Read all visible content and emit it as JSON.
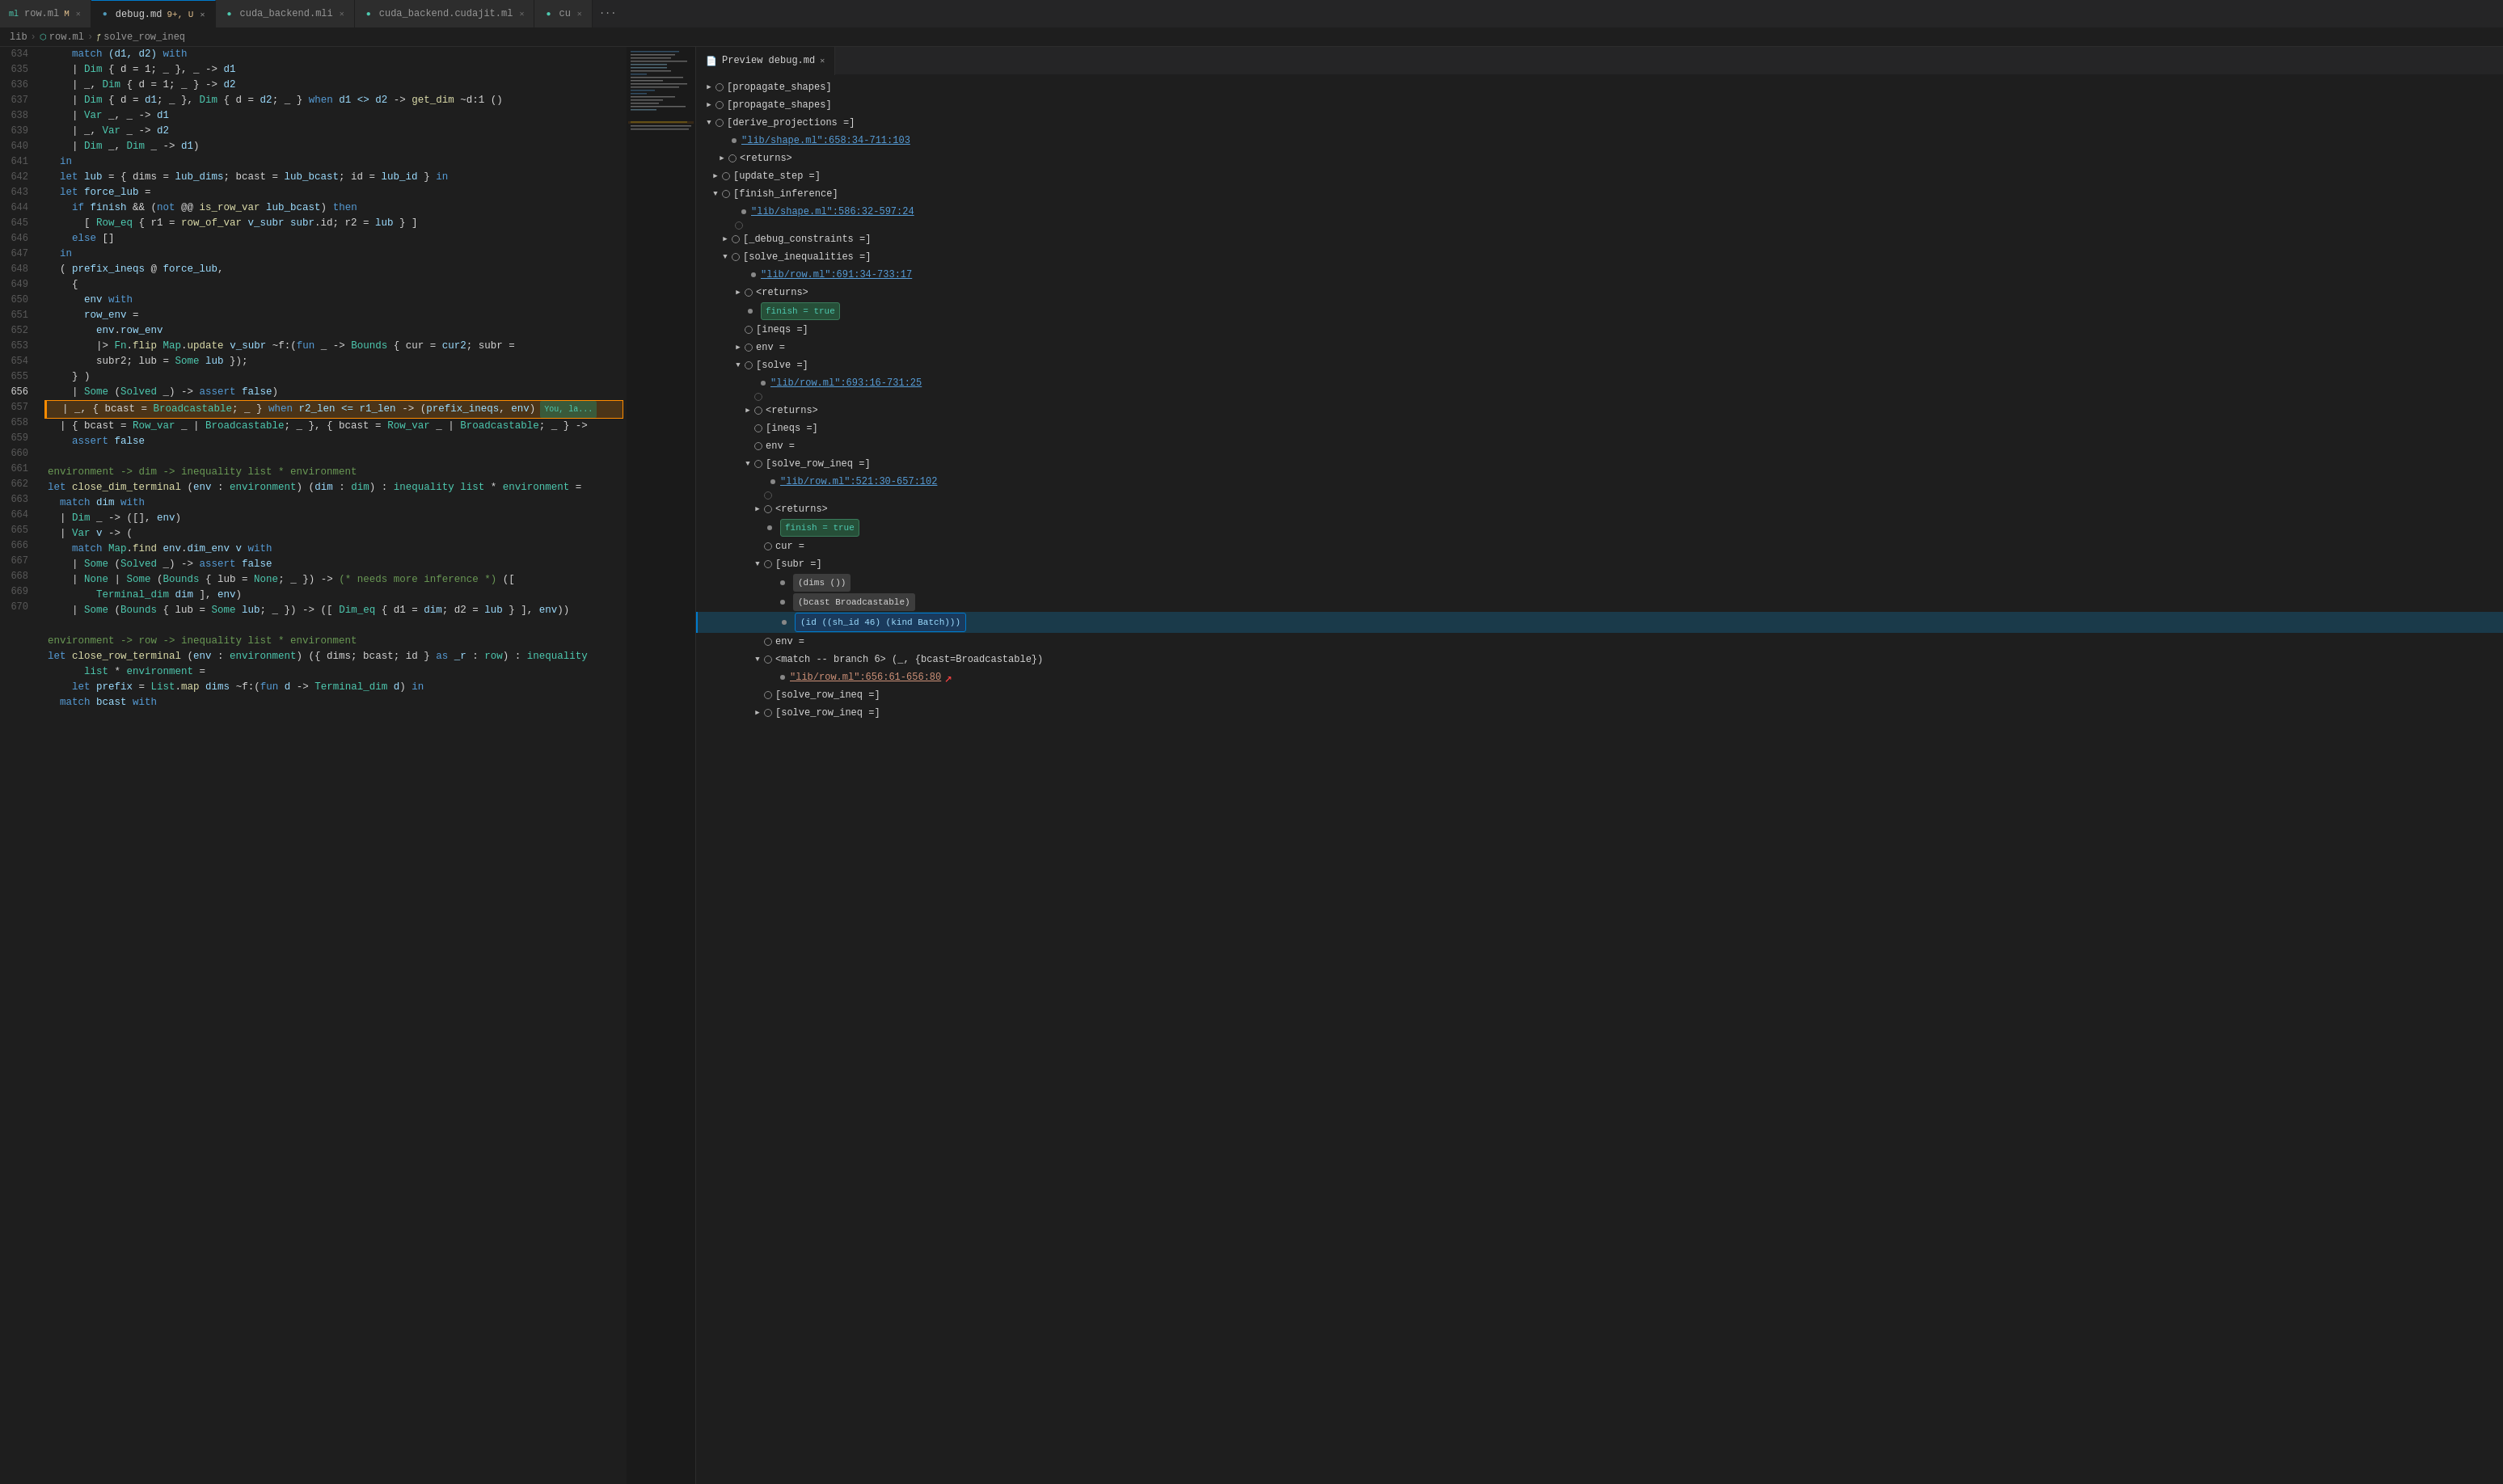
{
  "tabs": [
    {
      "id": "row-ml",
      "label": "row.ml",
      "modified": "M",
      "active": false,
      "icon": "ml"
    },
    {
      "id": "debug-md",
      "label": "debug.md",
      "modified": "9+, U",
      "active": true,
      "icon": "md"
    },
    {
      "id": "cuda-backend-mli",
      "label": "cuda_backend.mli",
      "modified": "",
      "active": false,
      "icon": "mli"
    },
    {
      "id": "cuda-backend-cudajit",
      "label": "cuda_backend.cudajit.ml",
      "modified": "",
      "active": false,
      "icon": "ml"
    },
    {
      "id": "cu",
      "label": "cu",
      "modified": "",
      "active": false,
      "icon": ""
    }
  ],
  "breadcrumb": {
    "parts": [
      "lib",
      "row.ml",
      "solve_row_ineq"
    ]
  },
  "lines": [
    {
      "num": 634,
      "text": "    match (d1, d2) with",
      "highlight": false
    },
    {
      "num": 635,
      "text": "    | Dim { d = 1; _ }, _ -> d1",
      "highlight": false
    },
    {
      "num": 636,
      "text": "    | _, Dim { d = 1; _ } -> d2",
      "highlight": false
    },
    {
      "num": 637,
      "text": "    | Dim { d = d1; _ }, Dim { d = d2; _ } when d1 <> d2 -> get_dim ~d:1 ()",
      "highlight": false
    },
    {
      "num": 638,
      "text": "    | Var _, _ -> d1",
      "highlight": false
    },
    {
      "num": 639,
      "text": "    | _, Var _ -> d2",
      "highlight": false
    },
    {
      "num": 640,
      "text": "    | Dim _, Dim _ -> d1)",
      "highlight": false
    },
    {
      "num": 641,
      "text": "  in",
      "highlight": false
    },
    {
      "num": 642,
      "text": "  let lub = { dims = lub_dims; bcast = lub_bcast; id = lub_id } in",
      "highlight": false
    },
    {
      "num": 643,
      "text": "  let force_lub =",
      "highlight": false
    },
    {
      "num": 644,
      "text": "    if finish && (not @@ is_row_var lub_bcast) then",
      "highlight": false
    },
    {
      "num": 645,
      "text": "      [ Row_eq { r1 = row_of_var v_subr subr.id; r2 = lub } ]",
      "highlight": false
    },
    {
      "num": 646,
      "text": "    else []",
      "highlight": false
    },
    {
      "num": 647,
      "text": "  in",
      "highlight": false
    },
    {
      "num": 648,
      "text": "  ( prefix_ineqs @ force_lub,",
      "highlight": false
    },
    {
      "num": 649,
      "text": "    {",
      "highlight": false
    },
    {
      "num": 650,
      "text": "      env with",
      "highlight": false
    },
    {
      "num": 651,
      "text": "      row_env =",
      "highlight": false
    },
    {
      "num": 652,
      "text": "        env.row_env",
      "highlight": false
    },
    {
      "num": 653,
      "text": "        |> Fn.flip Map.update v_subr ~f:(fun _ -> Bounds { cur = cur2; subr =",
      "highlight": false
    },
    {
      "num": 654,
      "text": "        subr2; lub = Some lub });",
      "highlight": false
    },
    {
      "num": 654,
      "text": "    } )",
      "highlight": false
    },
    {
      "num": 655,
      "text": "    | Some (Solved _) -> assert false)",
      "highlight": false
    },
    {
      "num": 656,
      "text": "  | _, { bcast = Broadcastable; _ } when r2_len <= r1_len -> (prefix_ineqs, env)",
      "highlight": true,
      "active": true,
      "you": true
    },
    {
      "num": 657,
      "text": "  | { bcast = Row_var _ | Broadcastable; _ }, { bcast = Row_var _ | Broadcastable; _ } ->",
      "highlight": false
    },
    {
      "num": 657,
      "text": "    assert false",
      "highlight": false
    },
    {
      "num": 658,
      "text": "",
      "highlight": false
    },
    {
      "num": 658,
      "text": "environment -> dim -> inequality list * environment",
      "highlight": false,
      "comment": true
    },
    {
      "num": 659,
      "text": "let close_dim_terminal (env : environment) (dim : dim) : inequality list * environment =",
      "highlight": false
    },
    {
      "num": 660,
      "text": "  match dim with",
      "highlight": false
    },
    {
      "num": 661,
      "text": "  | Dim _ -> ([], env)",
      "highlight": false
    },
    {
      "num": 662,
      "text": "  | Var v -> (",
      "highlight": false
    },
    {
      "num": 663,
      "text": "    match Map.find env.dim_env v with",
      "highlight": false
    },
    {
      "num": 664,
      "text": "    | Some (Solved _) -> assert false",
      "highlight": false
    },
    {
      "num": 665,
      "text": "    | None | Some (Bounds { lub = None; _ }) -> (* needs more inference *) ([",
      "highlight": false
    },
    {
      "num": 665,
      "text": "        Terminal_dim dim ], env)",
      "highlight": false
    },
    {
      "num": 666,
      "text": "    | Some (Bounds { lub = Some lub; _ }) -> ([ Dim_eq { d1 = dim; d2 = lub } ], env))",
      "highlight": false
    },
    {
      "num": 667,
      "text": "",
      "highlight": false
    },
    {
      "num": 668,
      "text": "environment -> row -> inequality list * environment",
      "highlight": false,
      "comment": true
    },
    {
      "num": 668,
      "text": "let close_row_terminal (env : environment) ({ dims; bcast; id } as _r : row) : inequality",
      "highlight": false
    },
    {
      "num": 668,
      "text": "      list * environment =",
      "highlight": false
    },
    {
      "num": 669,
      "text": "    let prefix = List.map dims ~f:(fun d -> Terminal_dim d) in",
      "highlight": false
    },
    {
      "num": 670,
      "text": "  match bcast with",
      "highlight": false
    }
  ],
  "debug_panel": {
    "tab_label": "Preview debug.md",
    "tree": [
      {
        "indent": 0,
        "arrow": "collapsed",
        "type": "circle",
        "label": "[propagate_shapes]",
        "level": 1
      },
      {
        "indent": 0,
        "arrow": "collapsed",
        "type": "circle",
        "label": "[propagate_shapes]",
        "level": 1
      },
      {
        "indent": 0,
        "arrow": "expanded",
        "type": "circle",
        "label": "[derive_projections =]",
        "level": 1
      },
      {
        "indent": 1,
        "arrow": "none",
        "type": "bullet",
        "label": "\"lib/shape.ml\":658:34-711:103",
        "level": 2,
        "link": true
      },
      {
        "indent": 1,
        "arrow": "collapsed",
        "type": "circle",
        "label": "<returns>",
        "level": 2
      },
      {
        "indent": 1,
        "arrow": "collapsed",
        "type": "circle",
        "label": "[update_step =]",
        "level": 2
      },
      {
        "indent": 1,
        "arrow": "expanded",
        "type": "circle",
        "label": "[finish_inference]",
        "level": 2
      },
      {
        "indent": 2,
        "arrow": "none",
        "type": "bullet",
        "label": "\"lib/shape.ml\":586:32-597:24",
        "level": 3,
        "link": true
      },
      {
        "indent": 2,
        "arrow": "none",
        "type": "circle",
        "label": "",
        "level": 3
      },
      {
        "indent": 2,
        "arrow": "collapsed",
        "type": "circle",
        "label": "[_debug_constraints =]",
        "level": 3
      },
      {
        "indent": 2,
        "arrow": "expanded",
        "type": "circle",
        "label": "[solve_inequalities =]",
        "level": 3
      },
      {
        "indent": 3,
        "arrow": "none",
        "type": "bullet",
        "label": "\"lib/row.ml\":691:34-733:17",
        "level": 4,
        "link": true
      },
      {
        "indent": 3,
        "arrow": "collapsed",
        "type": "circle",
        "label": "<returns>",
        "level": 4
      },
      {
        "indent": 3,
        "arrow": "none",
        "type": "bullet",
        "label": "finish = true",
        "level": 4,
        "badge": "finish-true"
      },
      {
        "indent": 3,
        "arrow": "none",
        "type": "circle",
        "label": "[ineqs =]",
        "level": 4
      },
      {
        "indent": 3,
        "arrow": "collapsed",
        "type": "circle",
        "label": "env =",
        "level": 4
      },
      {
        "indent": 3,
        "arrow": "expanded",
        "type": "circle",
        "label": "[solve =]",
        "level": 4
      },
      {
        "indent": 4,
        "arrow": "none",
        "type": "bullet",
        "label": "\"lib/row.ml\":693:16-731:25",
        "level": 5,
        "link": true
      },
      {
        "indent": 4,
        "arrow": "none",
        "type": "circle",
        "label": "",
        "level": 5
      },
      {
        "indent": 4,
        "arrow": "collapsed",
        "type": "circle",
        "label": "<returns>",
        "level": 5
      },
      {
        "indent": 4,
        "arrow": "none",
        "type": "circle",
        "label": "[ineqs =]",
        "level": 5
      },
      {
        "indent": 4,
        "arrow": "none",
        "type": "circle",
        "label": "env =",
        "level": 5
      },
      {
        "indent": 4,
        "arrow": "expanded",
        "type": "circle",
        "label": "[solve_row_ineq =]",
        "level": 5
      },
      {
        "indent": 5,
        "arrow": "none",
        "type": "bullet",
        "label": "\"lib/row.ml\":521:30-657:102",
        "level": 6,
        "link": true
      },
      {
        "indent": 5,
        "arrow": "none",
        "type": "circle",
        "label": "",
        "level": 6
      },
      {
        "indent": 5,
        "arrow": "collapsed",
        "type": "circle",
        "label": "<returns>",
        "level": 6
      },
      {
        "indent": 5,
        "arrow": "none",
        "type": "bullet",
        "label": "finish = true",
        "level": 6,
        "badge": "finish-true"
      },
      {
        "indent": 5,
        "arrow": "none",
        "type": "circle",
        "label": "cur =",
        "level": 6
      },
      {
        "indent": 5,
        "arrow": "expanded",
        "type": "circle",
        "label": "[subr =]",
        "level": 6
      },
      {
        "indent": 6,
        "arrow": "none",
        "type": "bullet",
        "label": "(dims ())",
        "level": 7
      },
      {
        "indent": 6,
        "arrow": "none",
        "type": "bullet",
        "label": "(bcast Broadcastable)",
        "level": 7
      },
      {
        "indent": 6,
        "arrow": "none",
        "type": "bullet",
        "label": "(id ((sh_id 46) (kind Batch)))",
        "level": 7,
        "highlight": true
      },
      {
        "indent": 5,
        "arrow": "none",
        "type": "circle",
        "label": "env =",
        "level": 6
      },
      {
        "indent": 5,
        "arrow": "expanded",
        "type": "circle",
        "label": "<match -- branch 6> (_, {bcast=Broadcastable})",
        "level": 6
      },
      {
        "indent": 6,
        "arrow": "none",
        "type": "bullet",
        "label": "\"lib/row.ml\":656:61-656:80",
        "level": 7,
        "link": true,
        "cursor": true
      },
      {
        "indent": 5,
        "arrow": "none",
        "type": "circle",
        "label": "[solve_row_ineq =]",
        "level": 6
      },
      {
        "indent": 5,
        "arrow": "collapsed",
        "type": "circle",
        "label": "[solve_row_ineq =]",
        "level": 6
      }
    ]
  }
}
